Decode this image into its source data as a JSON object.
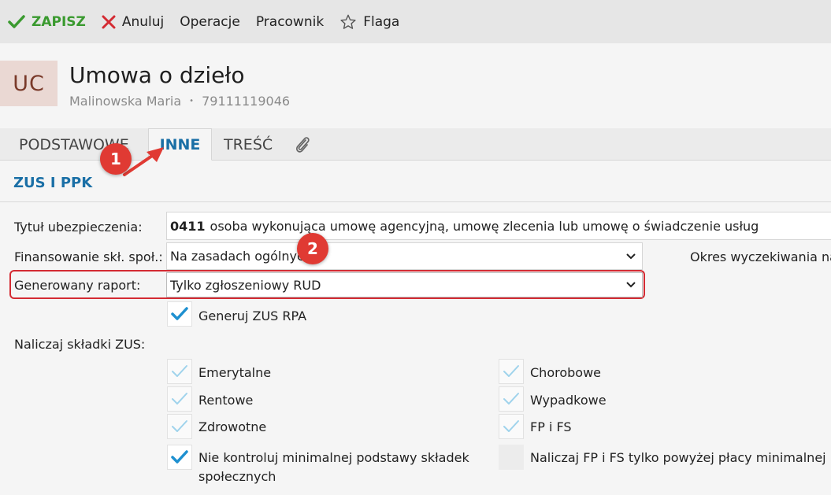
{
  "toolbar": {
    "save_label": "ZAPISZ",
    "cancel_label": "Anuluj",
    "operations_label": "Operacje",
    "employee_label": "Pracownik",
    "flag_label": "Flaga"
  },
  "header": {
    "avatar_initials": "UC",
    "title": "Umowa o dzieło",
    "person_name": "Malinowska Maria",
    "separator": "•",
    "person_id": "79111119046"
  },
  "tabs": [
    {
      "label": "PODSTAWOWE",
      "active": false
    },
    {
      "label": "INNE",
      "active": true
    },
    {
      "label": "TREŚĆ",
      "active": false
    },
    {
      "icon": "paperclip-icon"
    }
  ],
  "section": {
    "title": "ZUS I PPK"
  },
  "form": {
    "insurance_title": {
      "label": "Tytuł ubezpieczenia:",
      "code": "0411",
      "value": "osoba wykonująca umowę agencyjną, umowę zlecenia lub umowę o świadczenie usług"
    },
    "financing": {
      "label": "Finansowanie skł. społ.:",
      "value": "Na zasadach ogólnych"
    },
    "waiting_period": {
      "label": "Okres wyczekiwania na"
    },
    "report": {
      "label": "Generowany raport:",
      "value": "Tylko zgłoszeniowy RUD"
    },
    "generate_rpa": {
      "label": "Generuj ZUS RPA",
      "checked": true
    },
    "contributions_label": "Naliczaj składki ZUS:",
    "contributions": {
      "pension": {
        "label": "Emerytalne",
        "checked": true,
        "disabled": true
      },
      "disability": {
        "label": "Rentowe",
        "checked": true,
        "disabled": true
      },
      "health": {
        "label": "Zdrowotne",
        "checked": true,
        "disabled": true
      },
      "sickness": {
        "label": "Chorobowe",
        "checked": true,
        "disabled": true
      },
      "accident": {
        "label": "Wypadkowe",
        "checked": true,
        "disabled": true
      },
      "fp_fs": {
        "label": "FP i FS",
        "checked": true,
        "disabled": true
      }
    },
    "no_min_base": {
      "label_line1": "Nie kontroluj minimalnej podstawy składek",
      "label_line2": "społecznych",
      "checked": true
    },
    "fp_fs_above_min": {
      "label": "Naliczaj FP i FS tylko powyżej płacy minimalnej",
      "checked": false
    }
  },
  "annotations": [
    {
      "number": "1"
    },
    {
      "number": "2"
    }
  ],
  "colors": {
    "accent_blue": "#1a6fa6",
    "save_green": "#3a9a2f",
    "cancel_red": "#d42b33",
    "annotation_red": "#e03a33",
    "checkbox_blue": "#1e90d0",
    "checkbox_light": "#9fd3ec",
    "avatar_bg": "#ead8d3",
    "avatar_text": "#7a3a2a"
  }
}
